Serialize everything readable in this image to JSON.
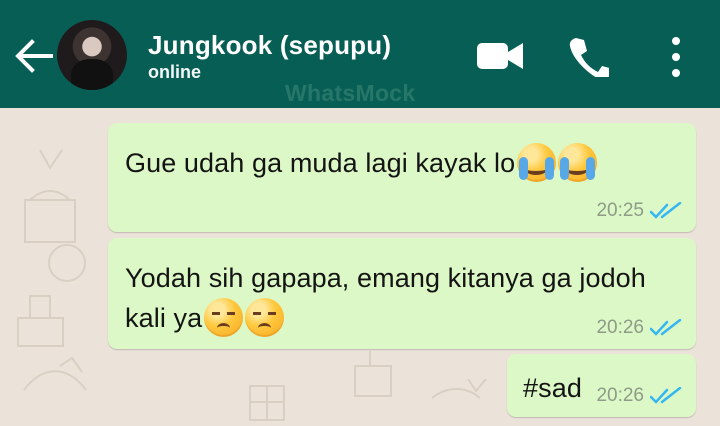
{
  "header": {
    "contact_name": "Jungkook (sepupu)",
    "status": "online",
    "watermark": "WhatsMock",
    "icons": [
      "back-arrow-icon",
      "video-call-icon",
      "phone-call-icon",
      "more-options-icon"
    ]
  },
  "messages": [
    {
      "text": "Gue udah ga muda lagi kayak lo",
      "emoji": [
        "crying-face",
        "crying-face"
      ],
      "time": "20:25",
      "status": "read"
    },
    {
      "text": "Yodah sih gapapa, emang kitanya ga jodoh\nkali ya",
      "emoji": [
        "pensive-face",
        "pensive-face"
      ],
      "time": "20:26",
      "status": "read"
    },
    {
      "text": "#sad",
      "emoji": [],
      "time": "20:26",
      "status": "read"
    }
  ],
  "colors": {
    "header": "#075e54",
    "bubble": "#dcf8c6",
    "background": "#ebe3d9",
    "read_ticks": "#34b7f1"
  }
}
